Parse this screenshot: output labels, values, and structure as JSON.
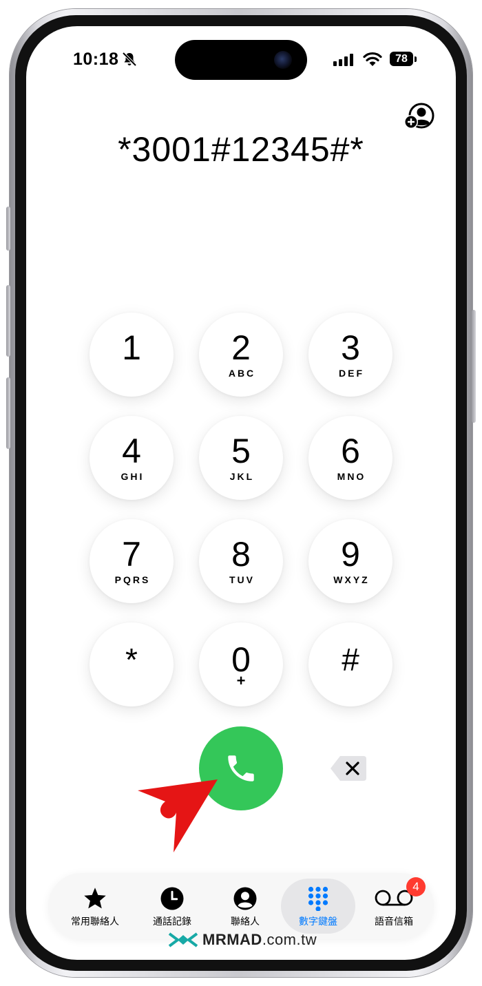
{
  "status_bar": {
    "time": "10:18",
    "battery": "78",
    "icons": [
      "bell-slash-icon",
      "cellular-signal-icon",
      "wifi-icon",
      "battery-icon"
    ]
  },
  "header": {
    "add_contact_icon": "person-plus-icon"
  },
  "display": {
    "number": "*3001#12345#*"
  },
  "keypad": {
    "keys": [
      {
        "digit": "1",
        "letters": ""
      },
      {
        "digit": "2",
        "letters": "ABC"
      },
      {
        "digit": "3",
        "letters": "DEF"
      },
      {
        "digit": "4",
        "letters": "GHI"
      },
      {
        "digit": "5",
        "letters": "JKL"
      },
      {
        "digit": "6",
        "letters": "MNO"
      },
      {
        "digit": "7",
        "letters": "PQRS"
      },
      {
        "digit": "8",
        "letters": "TUV"
      },
      {
        "digit": "9",
        "letters": "WXYZ"
      },
      {
        "digit": "*",
        "letters": ""
      },
      {
        "digit": "0",
        "letters": "+"
      },
      {
        "digit": "#",
        "letters": ""
      }
    ]
  },
  "actions": {
    "call_icon": "phone-icon",
    "call_color": "#34c759",
    "delete_icon": "delete-icon"
  },
  "tabs": [
    {
      "label": "常用聯絡人",
      "icon": "star-icon"
    },
    {
      "label": "通話記錄",
      "icon": "clock-icon"
    },
    {
      "label": "聯絡人",
      "icon": "person-circle-icon"
    },
    {
      "label": "數字鍵盤",
      "icon": "keypad-icon",
      "active": true
    },
    {
      "label": "語音信箱",
      "icon": "voicemail-icon",
      "badge": "4"
    }
  ],
  "colors": {
    "accent": "#007aff",
    "badge": "#ff3b30",
    "arrow": "#e51515"
  },
  "watermark": {
    "brand": "MRMAD",
    "domain": ".com.tw"
  }
}
